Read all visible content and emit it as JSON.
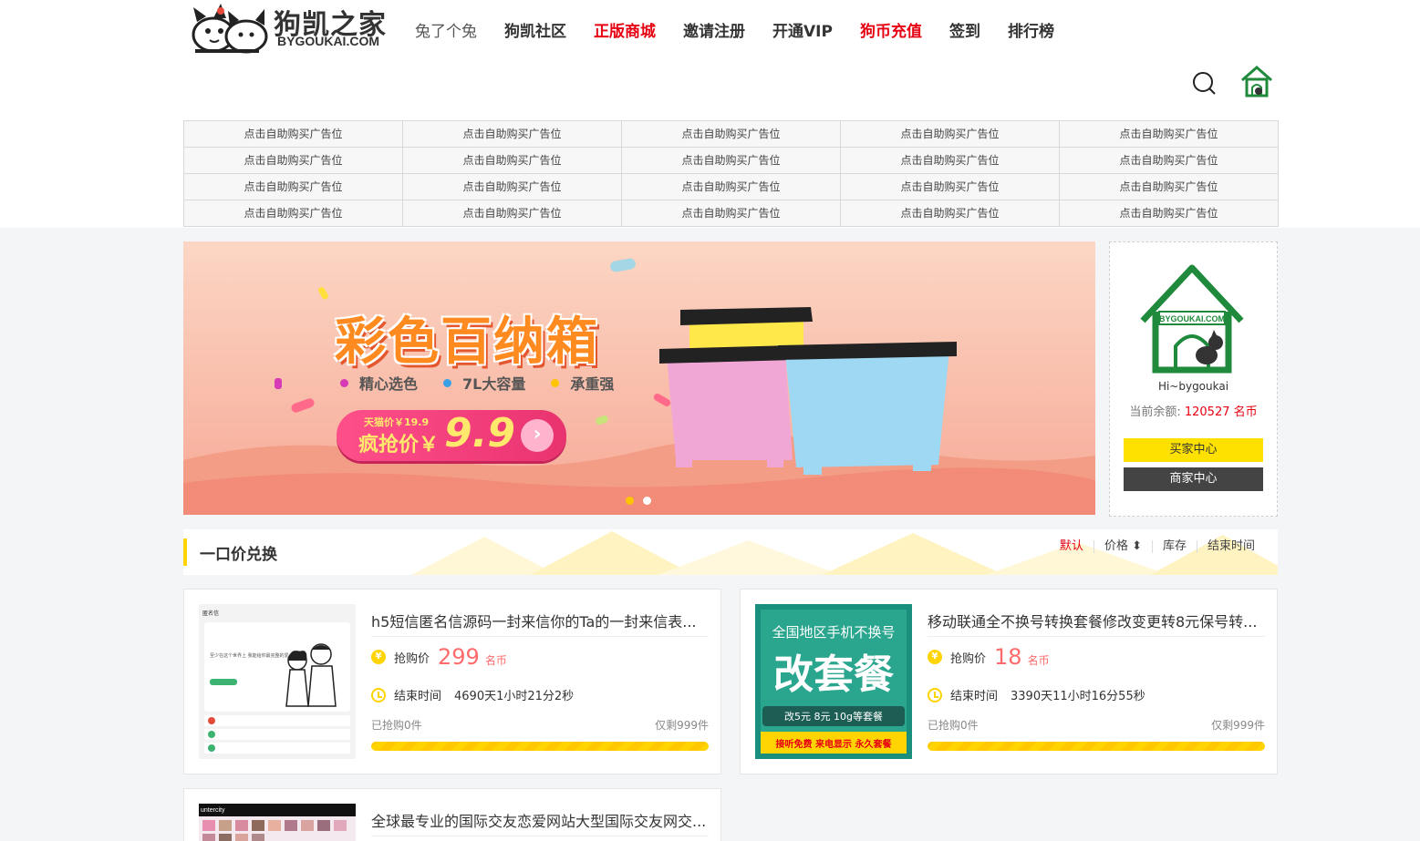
{
  "header": {
    "logo_text": "狗凯之家",
    "logo_sub": "BYGOUKAI.COM",
    "nav": [
      {
        "label": "兔了个兔",
        "style": "dim"
      },
      {
        "label": "狗凯社区",
        "style": "bold"
      },
      {
        "label": "正版商城",
        "style": "red"
      },
      {
        "label": "邀请注册",
        "style": "bold"
      },
      {
        "label": "开通VIP",
        "style": "bold"
      },
      {
        "label": "狗币充值",
        "style": "red"
      },
      {
        "label": "签到",
        "style": "bold"
      },
      {
        "label": "排行榜",
        "style": "bold"
      }
    ],
    "icons": {
      "search": "search-icon",
      "home": "home-icon"
    }
  },
  "ad_grid": {
    "cell_label": "点击自助购买广告位",
    "rows": 4,
    "cols": 5
  },
  "banner": {
    "title": "彩色百纳箱",
    "features": [
      "精心选色",
      "7L大容量",
      "承重强"
    ],
    "feature_colors": [
      "#d63ab6",
      "#3aa0e6",
      "#ffc400"
    ],
    "tmall_price": "天猫价￥19.9",
    "deal_label": "疯抢价￥",
    "deal_price": "9.9",
    "arrow": "›",
    "slides": 2,
    "active_slide": 0
  },
  "user_panel": {
    "logo_text": "BYGOUKAI.COM",
    "greeting": "Hi~bygoukai",
    "balance_label": "当前余额:",
    "balance_value": "120527",
    "balance_unit": "名币",
    "buyer_center": "买家中心",
    "seller_center": "商家中心"
  },
  "section": {
    "title": "一口价兑换",
    "sort_options": [
      "默认",
      "价格 ⬍",
      "库存",
      "结束时间"
    ],
    "active_sort": "默认"
  },
  "products": [
    {
      "title": "h5短信匿名信源码一封来信你的Ta的一封来信表...",
      "price_label": "抢购价",
      "price": "299",
      "unit": "名币",
      "time_label": "结束时间",
      "time_value": "4690天1小时21分2秒",
      "sold": "已抢购0件",
      "remaining": "仅剩999件",
      "thumb_header": "匿名信",
      "thumb_line": "至少在这个世界上 我能给你最完整的爱"
    },
    {
      "title": "移动联通全不换号转换套餐修改变更转8元保号转...",
      "price_label": "抢购价",
      "price": "18",
      "unit": "名币",
      "time_label": "结束时间",
      "time_value": "3390天11小时16分55秒",
      "sold": "已抢购0件",
      "remaining": "仅剩999件",
      "thumb_top": "全国地区手机不换号",
      "thumb_big": "改套餐",
      "thumb_mid": "改5元 8元 10g等套餐",
      "thumb_bottom": "接听免费 来电显示 永久套餐"
    },
    {
      "title": "全球最专业的国际交友恋爱网站大型国际交友网交...",
      "thumb_brand": "untercity"
    }
  ],
  "colors": {
    "accent_yellow": "#ffd400",
    "brand_red": "#e60012",
    "price_red": "#ff6b6b",
    "logo_green": "#1f8a3b"
  }
}
